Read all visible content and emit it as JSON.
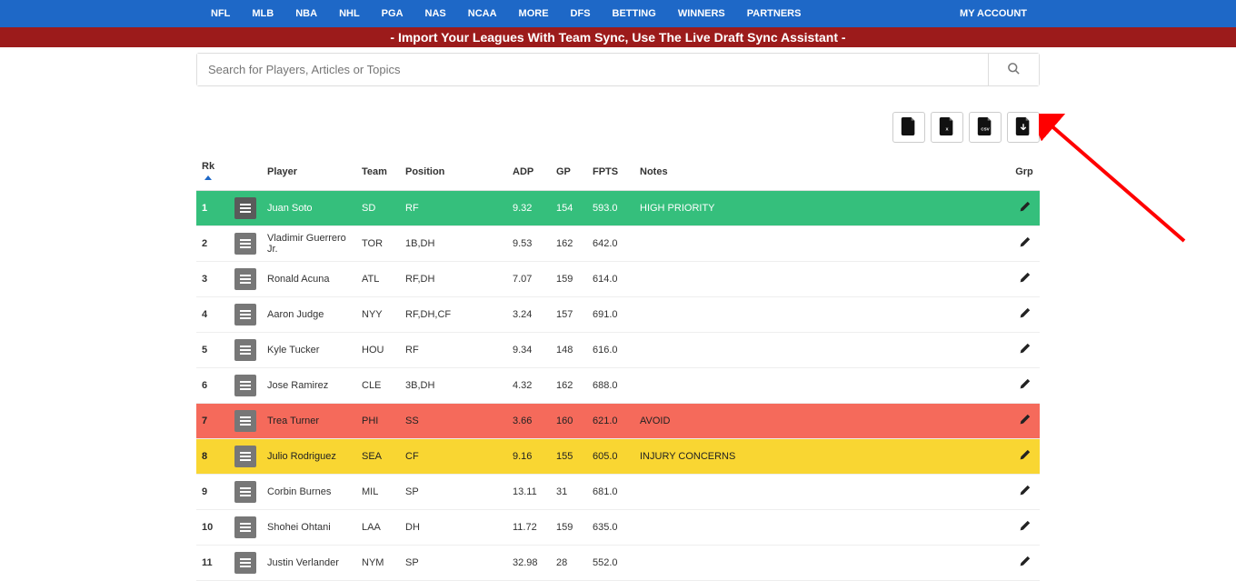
{
  "nav": {
    "items": [
      "NFL",
      "MLB",
      "NBA",
      "NHL",
      "PGA",
      "NAS",
      "NCAA",
      "MORE",
      "DFS",
      "BETTING",
      "WINNERS",
      "PARTNERS"
    ],
    "account": "MY ACCOUNT"
  },
  "banner": "- Import Your Leagues With Team Sync, Use The Live Draft Sync Assistant -",
  "search": {
    "placeholder": "Search for Players, Articles or Topics"
  },
  "export_icons": [
    "file-icon",
    "file-x-icon",
    "file-csv-icon",
    "file-pdf-icon"
  ],
  "columns": {
    "rk": "Rk",
    "player": "Player",
    "team": "Team",
    "position": "Position",
    "adp": "ADP",
    "gp": "GP",
    "fpts": "FPTS",
    "notes": "Notes",
    "grp": "Grp"
  },
  "rows": [
    {
      "rk": "1",
      "player": "Juan Soto",
      "team": "SD",
      "position": "RF",
      "adp": "9.32",
      "gp": "154",
      "fpts": "593.0",
      "notes": "HIGH PRIORITY",
      "style": "green"
    },
    {
      "rk": "2",
      "player": "Vladimir Guerrero Jr.",
      "team": "TOR",
      "position": "1B,DH",
      "adp": "9.53",
      "gp": "162",
      "fpts": "642.0",
      "notes": "",
      "style": ""
    },
    {
      "rk": "3",
      "player": "Ronald Acuna",
      "team": "ATL",
      "position": "RF,DH",
      "adp": "7.07",
      "gp": "159",
      "fpts": "614.0",
      "notes": "",
      "style": ""
    },
    {
      "rk": "4",
      "player": "Aaron Judge",
      "team": "NYY",
      "position": "RF,DH,CF",
      "adp": "3.24",
      "gp": "157",
      "fpts": "691.0",
      "notes": "",
      "style": ""
    },
    {
      "rk": "5",
      "player": "Kyle Tucker",
      "team": "HOU",
      "position": "RF",
      "adp": "9.34",
      "gp": "148",
      "fpts": "616.0",
      "notes": "",
      "style": ""
    },
    {
      "rk": "6",
      "player": "Jose Ramirez",
      "team": "CLE",
      "position": "3B,DH",
      "adp": "4.32",
      "gp": "162",
      "fpts": "688.0",
      "notes": "",
      "style": ""
    },
    {
      "rk": "7",
      "player": "Trea Turner",
      "team": "PHI",
      "position": "SS",
      "adp": "3.66",
      "gp": "160",
      "fpts": "621.0",
      "notes": "AVOID",
      "style": "red"
    },
    {
      "rk": "8",
      "player": "Julio Rodriguez",
      "team": "SEA",
      "position": "CF",
      "adp": "9.16",
      "gp": "155",
      "fpts": "605.0",
      "notes": "INJURY CONCERNS",
      "style": "yellow"
    },
    {
      "rk": "9",
      "player": "Corbin Burnes",
      "team": "MIL",
      "position": "SP",
      "adp": "13.11",
      "gp": "31",
      "fpts": "681.0",
      "notes": "",
      "style": ""
    },
    {
      "rk": "10",
      "player": "Shohei Ohtani",
      "team": "LAA",
      "position": "DH",
      "adp": "11.72",
      "gp": "159",
      "fpts": "635.0",
      "notes": "",
      "style": ""
    },
    {
      "rk": "11",
      "player": "Justin Verlander",
      "team": "NYM",
      "position": "SP",
      "adp": "32.98",
      "gp": "28",
      "fpts": "552.0",
      "notes": "",
      "style": ""
    }
  ]
}
